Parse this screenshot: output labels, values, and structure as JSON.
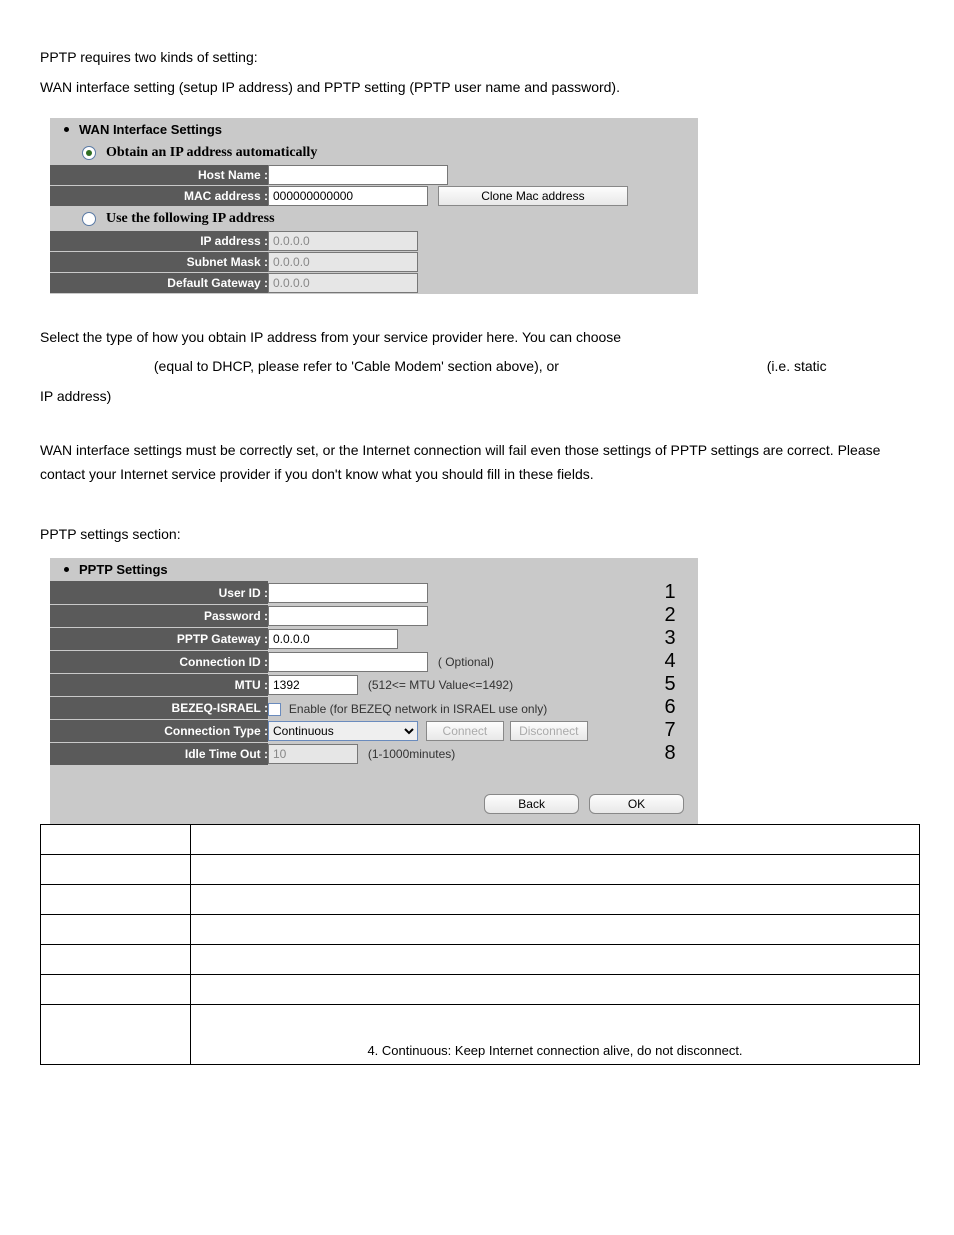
{
  "intro": {
    "line1": "PPTP requires two kinds of setting:",
    "line2": "WAN interface setting (setup IP address) and PPTP setting (PPTP user name and password)."
  },
  "wan": {
    "title": "WAN Interface Settings",
    "radio_auto": "Obtain an IP address automatically",
    "radio_static": "Use the following IP address",
    "host_name_label": "Host Name :",
    "host_name_value": "",
    "mac_label": "MAC address :",
    "mac_value": "000000000000",
    "clone_btn": "Clone Mac address",
    "ip_label": "IP address :",
    "ip_value": "0.0.0.0",
    "mask_label": "Subnet Mask :",
    "mask_value": "0.0.0.0",
    "gw_label": "Default Gateway :",
    "gw_value": "0.0.0.0"
  },
  "midtext": {
    "p1a": "Select the type of how you obtain IP address from your service provider here. You can choose",
    "p1b": "(equal to DHCP, please refer to 'Cable Modem' section above), or",
    "p1c": "(i.e. static",
    "p1d": "IP address)",
    "p2": "WAN interface settings must be correctly set, or the Internet connection will fail even those settings of PPTP settings are correct. Please contact your Internet service provider if you don't know what you should fill in these fields.",
    "p3": "PPTP settings section:"
  },
  "pptp": {
    "title": "PPTP Settings",
    "user_label": "User ID :",
    "user_value": "",
    "pw_label": "Password :",
    "pw_value": "",
    "gw_label": "PPTP Gateway :",
    "gw_value": "0.0.0.0",
    "conn_label": "Connection ID :",
    "conn_value": "",
    "conn_note": "( Optional)",
    "mtu_label": "MTU :",
    "mtu_value": "1392",
    "mtu_note": "(512<= MTU Value<=1492)",
    "bezeq_label": "BEZEQ-ISRAEL :",
    "bezeq_note": "Enable (for BEZEQ network in ISRAEL use only)",
    "ctype_label": "Connection Type :",
    "ctype_value": "Continuous",
    "connect_btn": "Connect",
    "disconnect_btn": "Disconnect",
    "idle_label": "Idle Time Out :",
    "idle_value": "10",
    "idle_note": "(1-1000minutes)",
    "back_btn": "Back",
    "ok_btn": "OK",
    "nums": {
      "n1": "1",
      "n2": "2",
      "n3": "3",
      "n4": "4",
      "n5": "5",
      "n6": "6",
      "n7": "7",
      "n8": "8"
    }
  },
  "desc_row7": "4.  Continuous: Keep Internet connection alive, do not disconnect."
}
